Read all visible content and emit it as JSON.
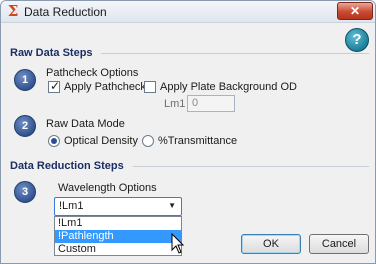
{
  "window": {
    "title": "Data Reduction",
    "icon": "sigma-icon",
    "close_glyph": "✕",
    "help_glyph": "?"
  },
  "raw_data_steps": {
    "header": "Raw Data Steps",
    "step1": {
      "number": "1",
      "title": "Pathcheck Options",
      "apply_pathcheck": {
        "label": "Apply Pathcheck",
        "checked": true
      },
      "apply_plate_background": {
        "label": "Apply Plate Background OD",
        "checked": false
      },
      "lm1": {
        "label": "Lm1",
        "value": "0"
      }
    },
    "step2": {
      "number": "2",
      "title": "Raw Data Mode",
      "options": [
        {
          "label": "Optical Density",
          "selected": true
        },
        {
          "label": "%Transmittance",
          "selected": false
        }
      ]
    }
  },
  "data_reduction_steps": {
    "header": "Data Reduction Steps",
    "step3": {
      "number": "3",
      "title": "Wavelength Options",
      "selected_value": "!Lm1",
      "dropdown_options": [
        "!Lm1",
        "!Pathlength",
        "Custom"
      ],
      "highlighted_option": "!Pathlength"
    }
  },
  "buttons": {
    "ok": "OK",
    "cancel": "Cancel"
  },
  "colors": {
    "section_header": "#1c2f63",
    "highlight": "#3399ff",
    "close_button": "#c94a33"
  }
}
